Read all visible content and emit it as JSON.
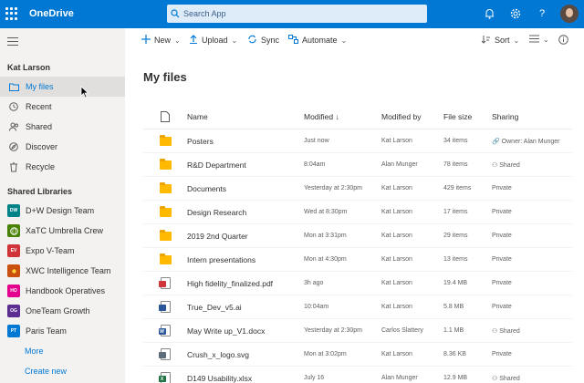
{
  "app": {
    "title": "OneDrive"
  },
  "search": {
    "placeholder": "Search App"
  },
  "colors": {
    "brand": "#0078d4",
    "folder": "#ffb900"
  },
  "sidebar": {
    "user": "Kat Larson",
    "nav": [
      {
        "label": "My files",
        "icon": "folder-outline-icon",
        "active": true
      },
      {
        "label": "Recent",
        "icon": "clock-icon"
      },
      {
        "label": "Shared",
        "icon": "people-icon"
      },
      {
        "label": "Discover",
        "icon": "compass-icon"
      },
      {
        "label": "Recycle",
        "icon": "trash-icon"
      }
    ],
    "libraries_title": "Shared Libraries",
    "libraries": [
      {
        "label": "D+W Design Team",
        "badge": "DW",
        "color": "#038387"
      },
      {
        "label": "XaTC Umbrella Crew",
        "badge": "",
        "color": "#498205"
      },
      {
        "label": "Expo V-Team",
        "badge": "EV",
        "color": "#d13438"
      },
      {
        "label": "XWC Intelligence Team",
        "badge": "",
        "color": "#ca5010"
      },
      {
        "label": "Handbook Operatives",
        "badge": "HO",
        "color": "#e3008c"
      },
      {
        "label": "OneTeam Growth",
        "badge": "OG",
        "color": "#5c2e91"
      },
      {
        "label": "Paris Team",
        "badge": "PT",
        "color": "#0078d4"
      }
    ],
    "more": "More",
    "create_new": "Create new"
  },
  "toolbar": {
    "new": "New",
    "upload": "Upload",
    "sync": "Sync",
    "automate": "Automate",
    "sort": "Sort"
  },
  "main": {
    "title": "My files",
    "columns": {
      "name": "Name",
      "modified": "Modified",
      "sort_arrow": "↓",
      "modified_by": "Modified by",
      "file_size": "File size",
      "sharing": "Sharing"
    },
    "rows": [
      {
        "type": "folder-shared",
        "name": "Posters",
        "modified": "Just now",
        "by": "Kat Larson",
        "size": "34 items",
        "sharing": "Owner: Alan Munger",
        "share_icon": "link-icon"
      },
      {
        "type": "folder",
        "name": "R&D Department",
        "modified": "8:04am",
        "by": "Alan Munger",
        "size": "78 items",
        "sharing": "Shared",
        "share_icon": "people-icon"
      },
      {
        "type": "folder",
        "name": "Documents",
        "modified": "Yesterday at 2:30pm",
        "by": "Kat Larson",
        "size": "429 items",
        "sharing": "Private",
        "share_icon": ""
      },
      {
        "type": "folder",
        "name": "Design Research",
        "modified": "Wed at 8:30pm",
        "by": "Kat Larson",
        "size": "17 items",
        "sharing": "Private",
        "share_icon": ""
      },
      {
        "type": "folder",
        "name": "2019 2nd Quarter",
        "modified": "Mon at 3:31pm",
        "by": "Kat Larson",
        "size": "29 items",
        "sharing": "Private",
        "share_icon": ""
      },
      {
        "type": "folder",
        "name": "Intern presentations",
        "modified": "Mon at 4:30pm",
        "by": "Kat Larson",
        "size": "13 items",
        "sharing": "Private",
        "share_icon": ""
      },
      {
        "type": "pdf",
        "name": "High fidelity_finalized.pdf",
        "modified": "3h ago",
        "by": "Kat Larson",
        "size": "19.4 MB",
        "sharing": "Private",
        "share_icon": ""
      },
      {
        "type": "ai",
        "name": "True_Dev_v5.ai",
        "modified": "10:04am",
        "by": "Kat Larson",
        "size": "5.8 MB",
        "sharing": "Private",
        "share_icon": ""
      },
      {
        "type": "word",
        "name": "May Write up_V1.docx",
        "modified": "Yesterday at 2:30pm",
        "by": "Carlos Slattery",
        "size": "1.1 MB",
        "sharing": "Shared",
        "share_icon": "people-icon"
      },
      {
        "type": "svg",
        "name": "Crush_x_logo.svg",
        "modified": "Mon at 3:02pm",
        "by": "Kat Larson",
        "size": "8.36 KB",
        "sharing": "Private",
        "share_icon": ""
      },
      {
        "type": "excel",
        "name": "D149 Usability.xlsx",
        "modified": "July 16",
        "by": "Alan Munger",
        "size": "12.9 MB",
        "sharing": "Shared",
        "share_icon": "people-icon"
      }
    ]
  }
}
